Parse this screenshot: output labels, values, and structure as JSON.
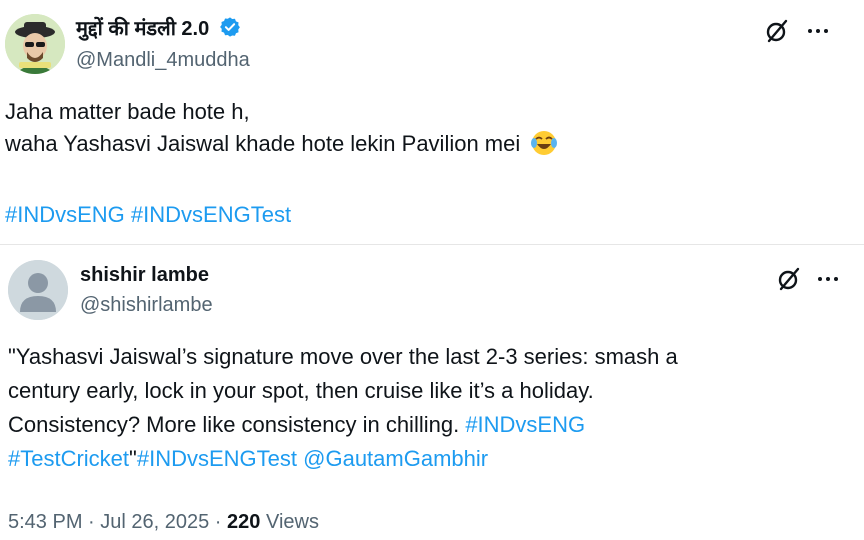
{
  "post1": {
    "author_name": "मुद्दों की मंडली 2.0",
    "handle": "@Mandli_4muddha",
    "verified": true,
    "lines": [
      "Jaha matter bade hote h,",
      "waha Yashasvi Jaiswal khade hote lekin Pavilion mei"
    ],
    "emoji": "laughing-with-tears-emoji",
    "hashtags": [
      "#INDvsENG",
      "#INDvsENGTest"
    ],
    "icons": [
      "grok-icon",
      "more-icon"
    ]
  },
  "post2": {
    "author_name": "shishir lambe",
    "handle": "@shishirlambe",
    "lines": [
      "\"Yashasvi Jaiswal’s signature move over the last 2-3 series: smash a",
      "century early, lock in your spot, then cruise like it’s a holiday.",
      "Consistency? More like consistency in chilling. "
    ],
    "tag_inline": "#INDvsENG",
    "tag_line4a": "#TestCricket",
    "quote_close": "\"",
    "tag_line4b": "#INDvsENGTest",
    "mention": "@GautamGambhir",
    "time": "5:43 PM",
    "sep": " · ",
    "date": "Jul 26, 2025",
    "views_count": "220",
    "views_label": " Views",
    "icons": [
      "grok-icon",
      "more-icon"
    ]
  },
  "colors": {
    "link": "#1d9bf0",
    "secondary": "#536471",
    "text": "#0f1419",
    "verified": "#1d9bf0"
  }
}
